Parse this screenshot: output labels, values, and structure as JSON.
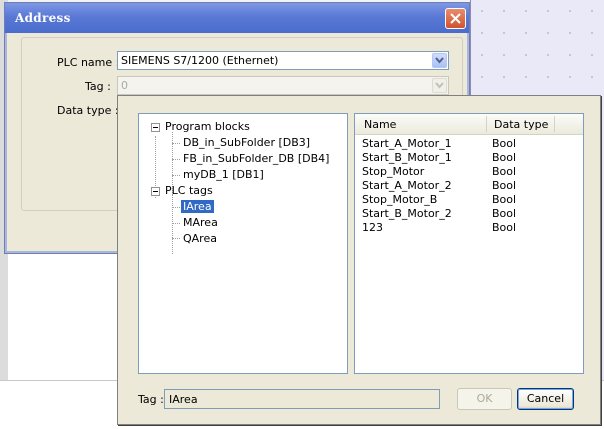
{
  "address_dialog": {
    "title": "Address",
    "plc_name_label": "PLC name :",
    "plc_name_value": "SIEMENS S7/1200 (Ethernet)",
    "tag_label": "Tag :",
    "tag_value": "0",
    "data_type_label": "Data type :"
  },
  "browser": {
    "tree": {
      "groups": [
        {
          "label": "Program blocks",
          "children": [
            "DB_in_SubFolder [DB3]",
            "FB_in_SubFolder_DB [DB4]",
            "myDB_1 [DB1]"
          ]
        },
        {
          "label": "PLC tags",
          "children": [
            "IArea",
            "MArea",
            "QArea"
          ]
        }
      ],
      "selected": "IArea"
    },
    "list": {
      "columns": [
        "Name",
        "Data type"
      ],
      "rows": [
        {
          "name": "Start_A_Motor_1",
          "type": "Bool"
        },
        {
          "name": "Start_B_Motor_1",
          "type": "Bool"
        },
        {
          "name": "Stop_Motor",
          "type": "Bool"
        },
        {
          "name": "Start_A_Motor_2",
          "type": "Bool"
        },
        {
          "name": "Stop_Motor_B",
          "type": "Bool"
        },
        {
          "name": "Start_B_Motor_2",
          "type": "Bool"
        },
        {
          "name": "123",
          "type": "Bool"
        }
      ]
    },
    "tag_label": "Tag :",
    "tag_value": "IArea",
    "ok_label": "OK",
    "cancel_label": "Cancel"
  },
  "colors": {
    "title_bar": "#5a79d6",
    "selection": "#316ac5",
    "close_button": "#d1532f"
  }
}
